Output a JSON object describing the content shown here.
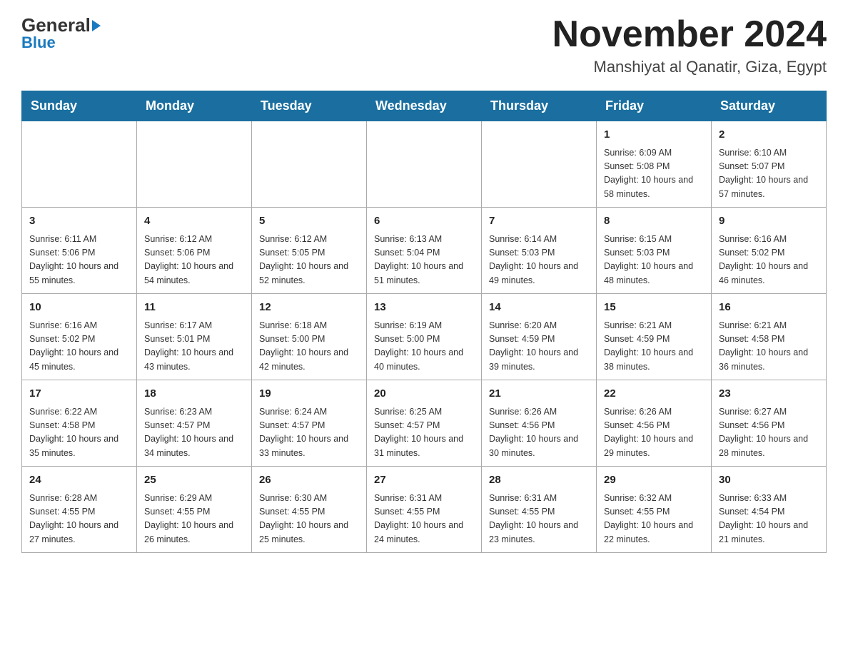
{
  "logo": {
    "general": "General",
    "blue": "Blue"
  },
  "title": "November 2024",
  "subtitle": "Manshiyat al Qanatir, Giza, Egypt",
  "weekdays": [
    "Sunday",
    "Monday",
    "Tuesday",
    "Wednesday",
    "Thursday",
    "Friday",
    "Saturday"
  ],
  "weeks": [
    [
      {
        "day": "",
        "info": ""
      },
      {
        "day": "",
        "info": ""
      },
      {
        "day": "",
        "info": ""
      },
      {
        "day": "",
        "info": ""
      },
      {
        "day": "",
        "info": ""
      },
      {
        "day": "1",
        "info": "Sunrise: 6:09 AM\nSunset: 5:08 PM\nDaylight: 10 hours and 58 minutes."
      },
      {
        "day": "2",
        "info": "Sunrise: 6:10 AM\nSunset: 5:07 PM\nDaylight: 10 hours and 57 minutes."
      }
    ],
    [
      {
        "day": "3",
        "info": "Sunrise: 6:11 AM\nSunset: 5:06 PM\nDaylight: 10 hours and 55 minutes."
      },
      {
        "day": "4",
        "info": "Sunrise: 6:12 AM\nSunset: 5:06 PM\nDaylight: 10 hours and 54 minutes."
      },
      {
        "day": "5",
        "info": "Sunrise: 6:12 AM\nSunset: 5:05 PM\nDaylight: 10 hours and 52 minutes."
      },
      {
        "day": "6",
        "info": "Sunrise: 6:13 AM\nSunset: 5:04 PM\nDaylight: 10 hours and 51 minutes."
      },
      {
        "day": "7",
        "info": "Sunrise: 6:14 AM\nSunset: 5:03 PM\nDaylight: 10 hours and 49 minutes."
      },
      {
        "day": "8",
        "info": "Sunrise: 6:15 AM\nSunset: 5:03 PM\nDaylight: 10 hours and 48 minutes."
      },
      {
        "day": "9",
        "info": "Sunrise: 6:16 AM\nSunset: 5:02 PM\nDaylight: 10 hours and 46 minutes."
      }
    ],
    [
      {
        "day": "10",
        "info": "Sunrise: 6:16 AM\nSunset: 5:02 PM\nDaylight: 10 hours and 45 minutes."
      },
      {
        "day": "11",
        "info": "Sunrise: 6:17 AM\nSunset: 5:01 PM\nDaylight: 10 hours and 43 minutes."
      },
      {
        "day": "12",
        "info": "Sunrise: 6:18 AM\nSunset: 5:00 PM\nDaylight: 10 hours and 42 minutes."
      },
      {
        "day": "13",
        "info": "Sunrise: 6:19 AM\nSunset: 5:00 PM\nDaylight: 10 hours and 40 minutes."
      },
      {
        "day": "14",
        "info": "Sunrise: 6:20 AM\nSunset: 4:59 PM\nDaylight: 10 hours and 39 minutes."
      },
      {
        "day": "15",
        "info": "Sunrise: 6:21 AM\nSunset: 4:59 PM\nDaylight: 10 hours and 38 minutes."
      },
      {
        "day": "16",
        "info": "Sunrise: 6:21 AM\nSunset: 4:58 PM\nDaylight: 10 hours and 36 minutes."
      }
    ],
    [
      {
        "day": "17",
        "info": "Sunrise: 6:22 AM\nSunset: 4:58 PM\nDaylight: 10 hours and 35 minutes."
      },
      {
        "day": "18",
        "info": "Sunrise: 6:23 AM\nSunset: 4:57 PM\nDaylight: 10 hours and 34 minutes."
      },
      {
        "day": "19",
        "info": "Sunrise: 6:24 AM\nSunset: 4:57 PM\nDaylight: 10 hours and 33 minutes."
      },
      {
        "day": "20",
        "info": "Sunrise: 6:25 AM\nSunset: 4:57 PM\nDaylight: 10 hours and 31 minutes."
      },
      {
        "day": "21",
        "info": "Sunrise: 6:26 AM\nSunset: 4:56 PM\nDaylight: 10 hours and 30 minutes."
      },
      {
        "day": "22",
        "info": "Sunrise: 6:26 AM\nSunset: 4:56 PM\nDaylight: 10 hours and 29 minutes."
      },
      {
        "day": "23",
        "info": "Sunrise: 6:27 AM\nSunset: 4:56 PM\nDaylight: 10 hours and 28 minutes."
      }
    ],
    [
      {
        "day": "24",
        "info": "Sunrise: 6:28 AM\nSunset: 4:55 PM\nDaylight: 10 hours and 27 minutes."
      },
      {
        "day": "25",
        "info": "Sunrise: 6:29 AM\nSunset: 4:55 PM\nDaylight: 10 hours and 26 minutes."
      },
      {
        "day": "26",
        "info": "Sunrise: 6:30 AM\nSunset: 4:55 PM\nDaylight: 10 hours and 25 minutes."
      },
      {
        "day": "27",
        "info": "Sunrise: 6:31 AM\nSunset: 4:55 PM\nDaylight: 10 hours and 24 minutes."
      },
      {
        "day": "28",
        "info": "Sunrise: 6:31 AM\nSunset: 4:55 PM\nDaylight: 10 hours and 23 minutes."
      },
      {
        "day": "29",
        "info": "Sunrise: 6:32 AM\nSunset: 4:55 PM\nDaylight: 10 hours and 22 minutes."
      },
      {
        "day": "30",
        "info": "Sunrise: 6:33 AM\nSunset: 4:54 PM\nDaylight: 10 hours and 21 minutes."
      }
    ]
  ]
}
